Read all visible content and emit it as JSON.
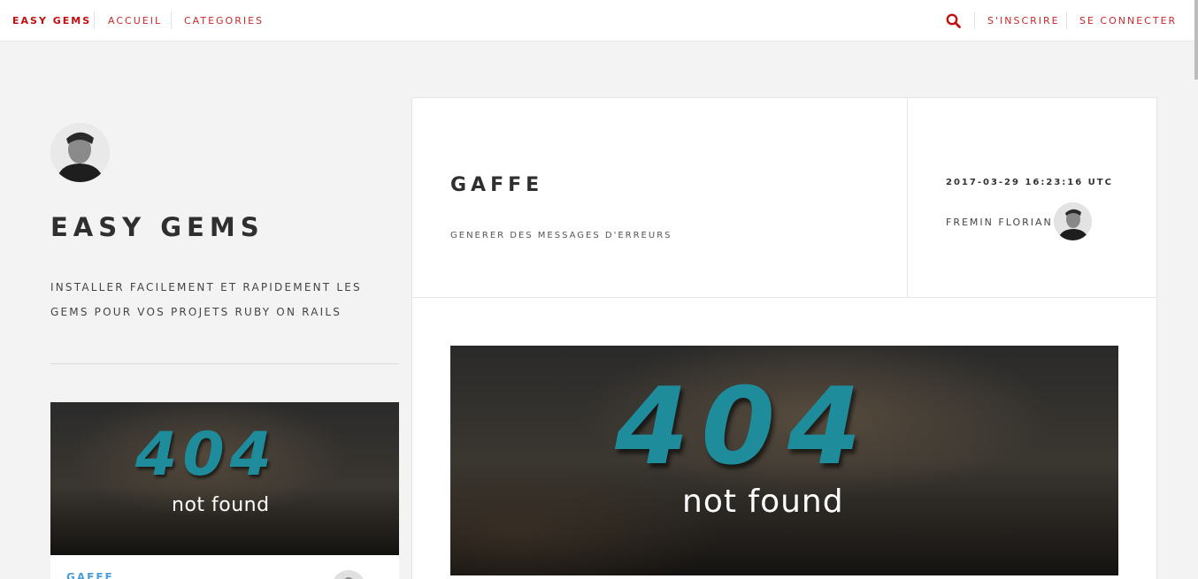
{
  "nav": {
    "brand": "EASY GEMS",
    "links": [
      "ACCUEIL",
      "CATEGORIES"
    ],
    "right_links": [
      "S'INSCRIRE",
      "SE CONNECTER"
    ],
    "search_icon": "search-icon"
  },
  "sidebar": {
    "title": "EASY GEMS",
    "description": "INSTALLER FACILEMENT ET RAPIDEMENT LES GEMS POUR VOS PROJETS RUBY ON RAILS",
    "card": {
      "title": "GAFFE",
      "image_text_big": "404",
      "image_text_small": "not found"
    }
  },
  "post": {
    "title": "GAFFE",
    "subtitle": "GENERER DES MESSAGES D'ERREURS",
    "date": "2017-03-29 16:23:16 UTC",
    "author": "FREMIN FLORIAN",
    "image_text_big": "404",
    "image_text_small": "not found"
  },
  "colors": {
    "accent": "#c40d0d",
    "link_blue": "#4a9fd8",
    "teal_404": "#1f8c9b",
    "page_bg": "#f3f3f3"
  }
}
